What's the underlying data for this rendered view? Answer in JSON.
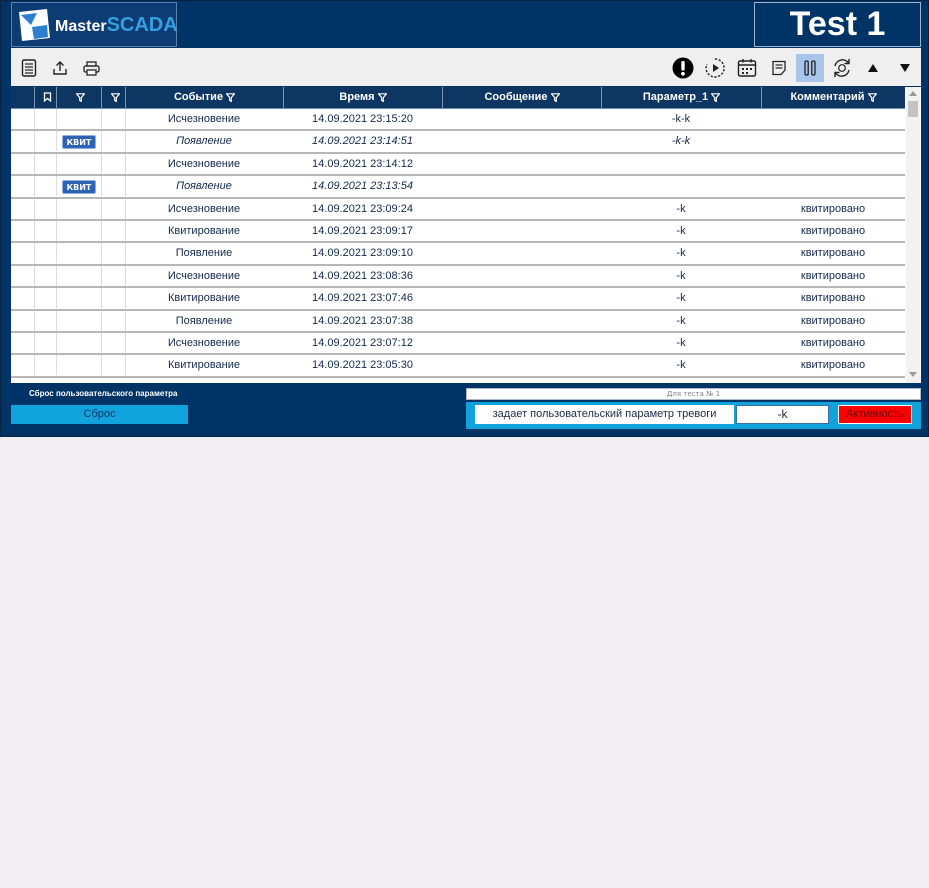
{
  "app": {
    "logo_text_master": "Master",
    "logo_text_scada": "SCADA",
    "title": "Test 1"
  },
  "toolbar": {
    "left_icons": [
      "list-icon",
      "export-icon",
      "print-icon"
    ],
    "right_icons": [
      "alert-icon",
      "play-icon",
      "calendar-icon",
      "notes-icon",
      "pause-icon",
      "refresh-icon",
      "arrow-up-icon",
      "arrow-down-icon"
    ]
  },
  "table": {
    "columns": [
      "",
      "",
      "",
      "Событие",
      "Время",
      "Сообщение",
      "Параметр_1",
      "Комментарий"
    ],
    "ack_label": "КВИТ",
    "rows": [
      {
        "event": "Исчезновение",
        "time": "14.09.2021 23:15:20",
        "message": "",
        "param": "-k-k",
        "comment": "",
        "ack": false,
        "italic": false
      },
      {
        "event": "Появление",
        "time": "14.09.2021 23:14:51",
        "message": "",
        "param": "-k-k",
        "comment": "",
        "ack": true,
        "italic": true
      },
      {
        "event": "Исчезновение",
        "time": "14.09.2021 23:14:12",
        "message": "",
        "param": "",
        "comment": "",
        "ack": false,
        "italic": false
      },
      {
        "event": "Появление",
        "time": "14.09.2021 23:13:54",
        "message": "",
        "param": "",
        "comment": "",
        "ack": true,
        "italic": true
      },
      {
        "event": "Исчезновение",
        "time": "14.09.2021 23:09:24",
        "message": "",
        "param": "-k",
        "comment": "квитировано",
        "ack": false,
        "italic": false
      },
      {
        "event": "Квитирование",
        "time": "14.09.2021 23:09:17",
        "message": "",
        "param": "-k",
        "comment": "квитировано",
        "ack": false,
        "italic": false
      },
      {
        "event": "Появление",
        "time": "14.09.2021 23:09:10",
        "message": "",
        "param": "-k",
        "comment": "квитировано",
        "ack": false,
        "italic": false
      },
      {
        "event": "Исчезновение",
        "time": "14.09.2021 23:08:36",
        "message": "",
        "param": "-k",
        "comment": "квитировано",
        "ack": false,
        "italic": false
      },
      {
        "event": "Квитирование",
        "time": "14.09.2021 23:07:46",
        "message": "",
        "param": "-k",
        "comment": "квитировано",
        "ack": false,
        "italic": false
      },
      {
        "event": "Появление",
        "time": "14.09.2021 23:07:38",
        "message": "",
        "param": "-k",
        "comment": "квитировано",
        "ack": false,
        "italic": false
      },
      {
        "event": "Исчезновение",
        "time": "14.09.2021 23:07:12",
        "message": "",
        "param": "-k",
        "comment": "квитировано",
        "ack": false,
        "italic": false
      },
      {
        "event": "Квитирование",
        "time": "14.09.2021 23:05:30",
        "message": "",
        "param": "-k",
        "comment": "квитировано",
        "ack": false,
        "italic": false
      }
    ]
  },
  "reset": {
    "label": "Сброс пользовательского параметра",
    "button": "Сброс"
  },
  "test_panel": {
    "caption": "Для теста № 1",
    "text": "задает пользовательский параметр тревоги",
    "value": "-k",
    "activity": "Активность"
  },
  "colors": {
    "header_bg": "#003366",
    "accent": "#11a3dc",
    "alarm": "#ff0000"
  }
}
